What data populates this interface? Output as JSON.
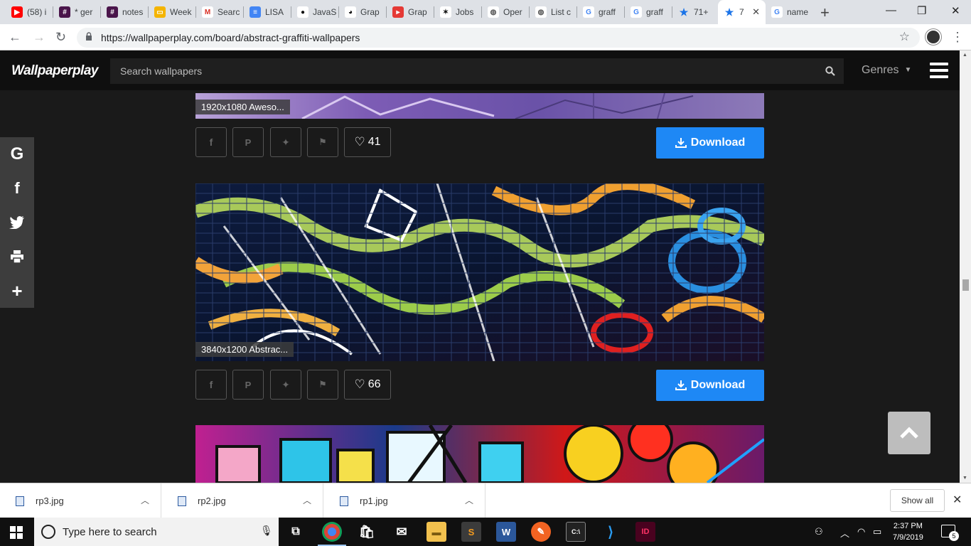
{
  "browser": {
    "tabs": [
      {
        "label": "(58) i",
        "fav_color": "#ff0000",
        "fav_glyph": "▶"
      },
      {
        "label": "* ger",
        "fav_color": "#4a154b",
        "fav_glyph": "#"
      },
      {
        "label": "notes",
        "fav_color": "#4a154b",
        "fav_glyph": "#"
      },
      {
        "label": "Week",
        "fav_color": "#f4b400",
        "fav_glyph": "▭"
      },
      {
        "label": "Searc",
        "fav_color": "#ffffff",
        "fav_glyph": "M"
      },
      {
        "label": "LISA",
        "fav_color": "#4285f4",
        "fav_glyph": "≡"
      },
      {
        "label": "JavaS",
        "fav_color": "#ffffff",
        "fav_glyph": "●"
      },
      {
        "label": "Grap",
        "fav_color": "#ffffff",
        "fav_glyph": "◕"
      },
      {
        "label": "Grap",
        "fav_color": "#e53935",
        "fav_glyph": "▸"
      },
      {
        "label": "Jobs",
        "fav_color": "#ffffff",
        "fav_glyph": "✶"
      },
      {
        "label": "Oper",
        "fav_color": "#ffffff",
        "fav_glyph": "◍"
      },
      {
        "label": "List c",
        "fav_color": "#ffffff",
        "fav_glyph": "◍"
      },
      {
        "label": "graff",
        "fav_color": "#ffffff",
        "fav_glyph": "G"
      },
      {
        "label": "graff",
        "fav_color": "#ffffff",
        "fav_glyph": "G"
      },
      {
        "label": "71+",
        "fav_color": "#dee1e6",
        "fav_glyph": "★"
      },
      {
        "label": "7",
        "fav_color": "#ffffff",
        "fav_glyph": "★"
      },
      {
        "label": "name",
        "fav_color": "#ffffff",
        "fav_glyph": "G"
      }
    ],
    "url": "https://wallpaperplay.com/board/abstract-graffiti-wallpapers"
  },
  "site": {
    "logo": "Wallpaperplay",
    "search_placeholder": "Search wallpapers",
    "genres_label": "Genres"
  },
  "cards": [
    {
      "caption": "1920x1080 Aweso...",
      "likes": "41",
      "download_label": "Download"
    },
    {
      "caption": "3840x1200 Abstrac...",
      "likes": "66",
      "download_label": "Download"
    }
  ],
  "downloads": {
    "items": [
      "rp3.jpg",
      "rp2.jpg",
      "rp1.jpg"
    ],
    "show_all": "Show all"
  },
  "taskbar": {
    "search_text": "Type here to search",
    "time": "2:37 PM",
    "date": "7/9/2019",
    "notification_count": "5"
  },
  "colors": {
    "accent": "#1e88f5",
    "page_bg": "#1a1a1a",
    "header_bg": "#0f0f0f"
  }
}
